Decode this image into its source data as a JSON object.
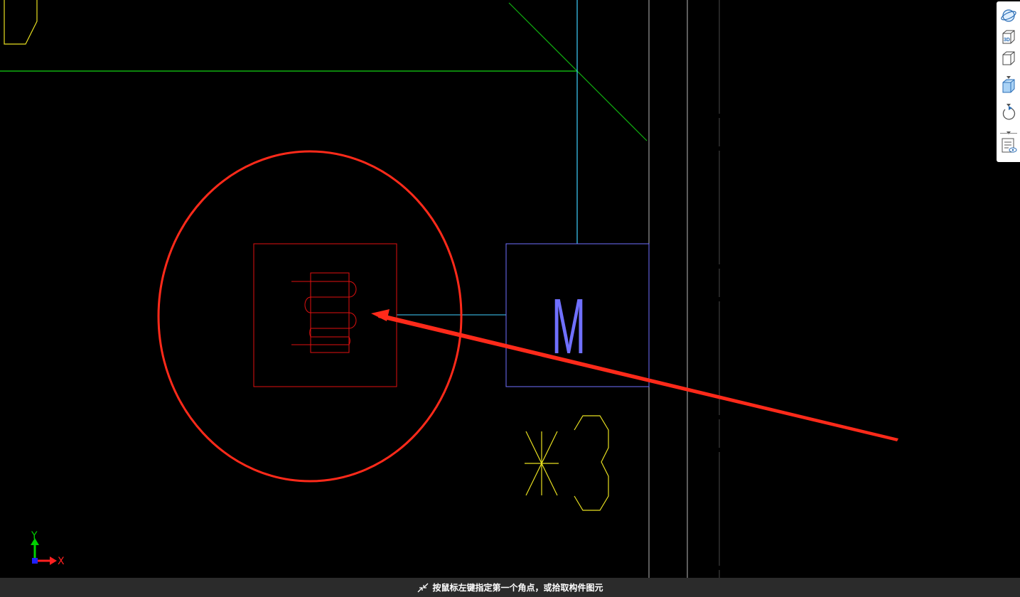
{
  "colors": {
    "background": "#000000",
    "status_bg": "#2b2b2b",
    "annotation_red": "#ff2a1a",
    "cad_red": "#e01010",
    "cad_blue": "#7070ff",
    "cad_cyan": "#40d0ff",
    "cad_green": "#10b010",
    "cad_yellow": "#e8e020",
    "cad_grey": "#b8b8b8"
  },
  "canvas": {
    "motor_label": "M",
    "ucs": {
      "y_label": "Y",
      "x_label": "X"
    }
  },
  "toolbar": {
    "buttons": [
      {
        "name": "orbit-button",
        "icon": "orbit-icon"
      },
      {
        "name": "3d-view-button",
        "icon": "cube-3d-icon",
        "label": "3D"
      },
      {
        "name": "view-cube-button",
        "icon": "cube-outline-icon"
      },
      {
        "name": "shaded-cube-button",
        "icon": "cube-shaded-icon"
      },
      {
        "name": "rotate-button",
        "icon": "rotate-icon"
      },
      {
        "name": "layer-list-button",
        "icon": "list-eye-icon"
      }
    ]
  },
  "statusbar": {
    "icon": "pick-corner-icon",
    "text": "按鼠标左键指定第一个角点，或拾取构件图元"
  }
}
